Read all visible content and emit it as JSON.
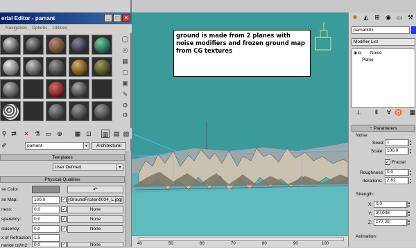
{
  "material_editor": {
    "title": "erial Editor - pamant",
    "menu": [
      "Navigation",
      "Options",
      "Utilities"
    ],
    "material_name": "pamant",
    "material_type_button": "Architectural",
    "templates_header": "Templates",
    "template_value": "User Defined",
    "physical_header": "Physical Qualities",
    "params": [
      {
        "label": "se Color:",
        "value": "",
        "map": ""
      },
      {
        "label": "se Map:",
        "value": "100,0",
        "map": "(GroundFrozen0034_L.jpg)"
      },
      {
        "label": "ness:",
        "value": "0,0",
        "map": "None"
      },
      {
        "label": "sparency:",
        "value": "0,0",
        "map": "None"
      },
      {
        "label": "slucency:",
        "value": "0,0",
        "map": "None"
      },
      {
        "label": "x of Refraction:",
        "value": "1,5",
        "map": ""
      },
      {
        "label": "nance cd/m2:",
        "value": "0,0",
        "map": "None"
      }
    ],
    "undo_glyph": "↶"
  },
  "annotation": {
    "text": "ground is made from 2 planes with noise modifiers and frozen ground map from CG textures"
  },
  "timeline": {
    "ticks": [
      "40",
      "50",
      "60",
      "70",
      "80",
      "90",
      "100"
    ]
  },
  "command_panel": {
    "object_name": "pamant01",
    "modifier_list_label": "Modifier List",
    "stack": [
      "Noise",
      "Plane"
    ],
    "parameters_header": "Parameters",
    "noise_group": "Noise:",
    "seed_label": "Seed:",
    "seed_value": "1",
    "scale_label": "Scale:",
    "scale_value": "100,0",
    "fractal_label": "Fractal",
    "roughness_label": "Roughness:",
    "roughness_value": "0,0",
    "iterations_label": "Iterations:",
    "iterations_value": "2,62",
    "strength_group": "Strength:",
    "x_label": "X:",
    "x_value": "0,0",
    "y_label": "Y:",
    "y_value": "30,038",
    "z_label": "Z:",
    "z_value": "177,22",
    "animation_group": "Animation:"
  },
  "colors": {
    "viewport_sky": "#3b9a9a",
    "viewport_ground": "#57b3b6",
    "title_bar": "#0a246a",
    "panel_bg": "#cfcfcf",
    "noise_modifier_color": "#2c2cff"
  }
}
